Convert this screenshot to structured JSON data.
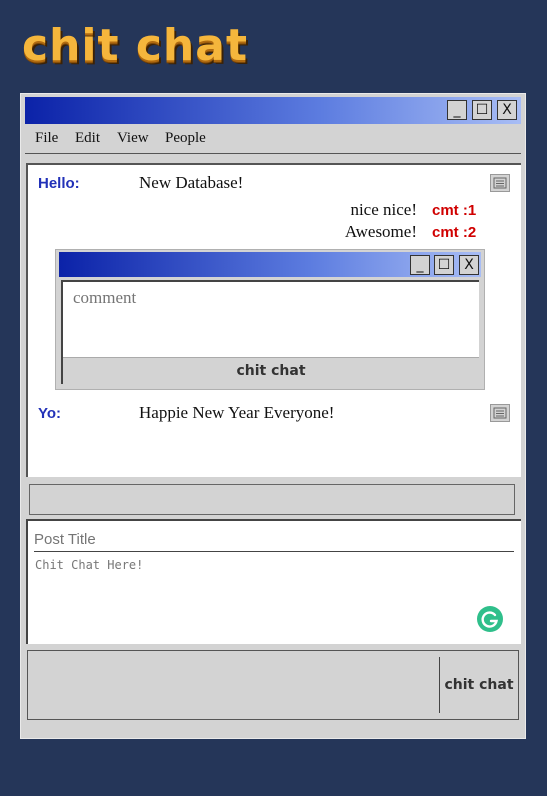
{
  "app": {
    "logo_text": "chit chat"
  },
  "window": {
    "controls": {
      "minimize": "_",
      "maximize": "☐",
      "close": "X"
    },
    "menu": [
      "File",
      "Edit",
      "View",
      "People"
    ]
  },
  "posts": [
    {
      "label": "Hello:",
      "text": "New Database!",
      "comments": [
        {
          "text": "nice nice!",
          "count": "cmt :1"
        },
        {
          "text": "Awesome!",
          "count": "cmt :2"
        }
      ]
    },
    {
      "label": "Yo:",
      "text": "Happie New Year Everyone!"
    }
  ],
  "comment_popup": {
    "controls": {
      "minimize": "_",
      "maximize": "☐",
      "close": "X"
    },
    "placeholder": "comment",
    "submit_label": "chit chat"
  },
  "compose": {
    "title_placeholder": "Post Title",
    "body_placeholder": "Chit Chat Here!",
    "submit_label": "chit chat"
  },
  "colors": {
    "background": "#253659",
    "title_gradient_start": "#0b22a8",
    "label_blue": "#2231b8",
    "count_red": "#d00000",
    "grammar_green": "#2fbf8b"
  }
}
